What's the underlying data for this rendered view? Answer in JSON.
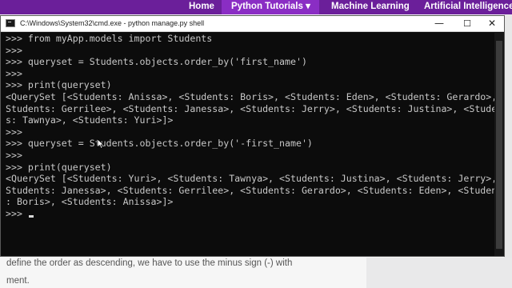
{
  "nav": {
    "home": "Home",
    "python_tutorials": "Python Tutorials",
    "python_chevron": "▾",
    "machine_learning": "Machine Learning",
    "artificial_intelligence": "Artificial Intelligence"
  },
  "article": {
    "line1": "define the order as descending, we have to use the minus sign (-) with",
    "line2": "ment."
  },
  "console": {
    "title": "C:\\Windows\\System32\\cmd.exe - python  manage.py shell",
    "minimize_glyph": "—",
    "maximize_glyph": "☐",
    "close_glyph": "✕",
    "lines": [
      ">>> from myApp.models import Students",
      ">>>",
      ">>> queryset = Students.objects.order_by('first_name')",
      ">>>",
      ">>> print(queryset)",
      "<QuerySet [<Students: Anissa>, <Students: Boris>, <Students: Eden>, <Students: Gerardo>, <",
      "Students: Gerrilee>, <Students: Janessa>, <Students: Jerry>, <Students: Justina>, <Student",
      "s: Tawnya>, <Students: Yuri>]>",
      ">>>",
      ">>> queryset = Students.objects.order_by('-first_name')",
      ">>>",
      ">>> print(queryset)",
      "<QuerySet [<Students: Yuri>, <Students: Tawnya>, <Students: Justina>, <Students: Jerry>, <",
      "Students: Janessa>, <Students: Gerrilee>, <Students: Gerardo>, <Students: Eden>, <Students",
      ": Boris>, <Students: Anissa>]>",
      ">>>"
    ]
  }
}
